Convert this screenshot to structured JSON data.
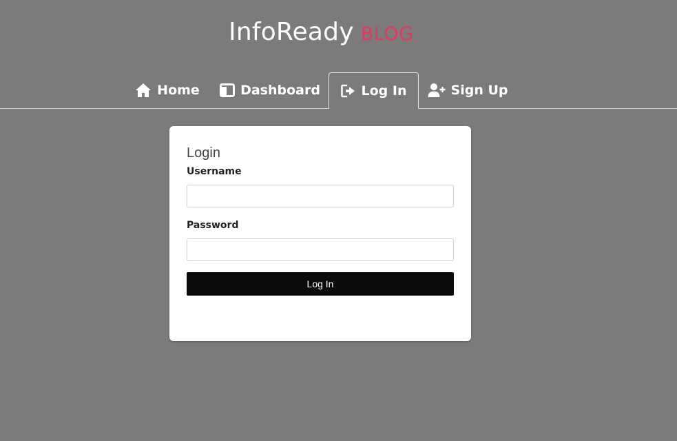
{
  "brand": {
    "name": "InfoReady",
    "tag": "BLOG"
  },
  "nav": {
    "items": [
      {
        "label": "Home",
        "icon": "home-icon"
      },
      {
        "label": "Dashboard",
        "icon": "dashboard-icon"
      },
      {
        "label": "Log In",
        "icon": "login-icon",
        "active": true
      },
      {
        "label": "Sign Up",
        "icon": "user-plus-icon"
      }
    ]
  },
  "login_form": {
    "title": "Login",
    "username_label": "Username",
    "username_value": "",
    "password_label": "Password",
    "password_value": "",
    "submit_label": "Log In"
  },
  "colors": {
    "background": "#7b7b7b",
    "brand_accent": "#e8365f",
    "button": "#0b0b0b"
  }
}
